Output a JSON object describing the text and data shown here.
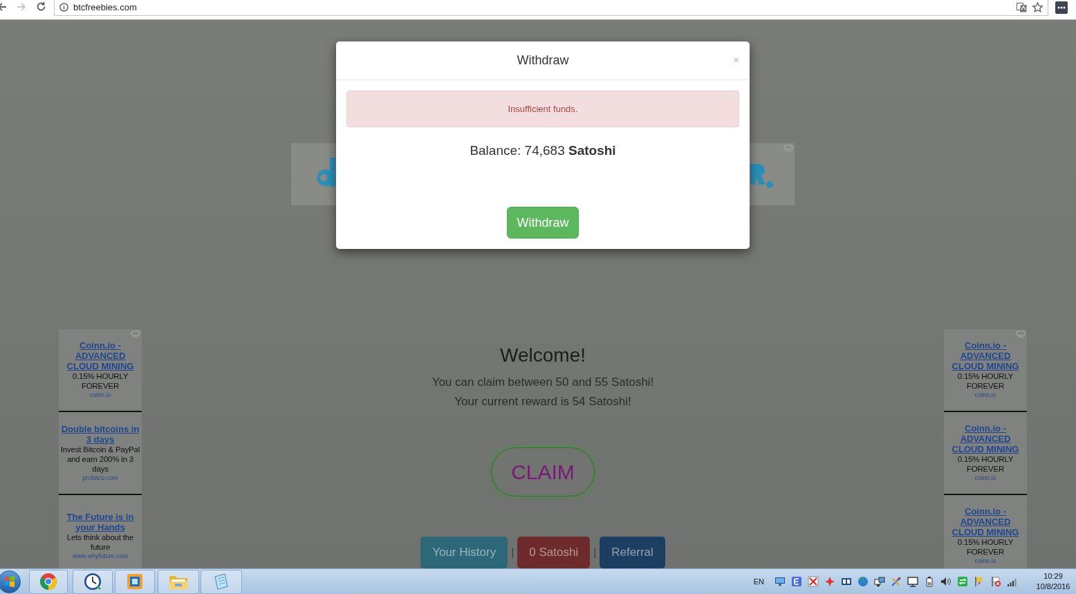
{
  "browser": {
    "url": "btcfreebies.com",
    "forward_disabled": true
  },
  "modal": {
    "title": "Withdraw",
    "close": "×",
    "alert": "Insufficient funds.",
    "balance": "Balance: 74,683 **Satoshi**",
    "button": "Withdraw"
  },
  "welcome": {
    "title": "Welcome!",
    "lines": [
      "You can claim between 50 and 55 Satoshi!",
      "Your current reward is 54 Satoshi!"
    ],
    "claim": "CLAIM"
  },
  "nav": [
    {
      "kind": "button",
      "label": "Your History",
      "color": "#2d6878"
    },
    {
      "kind": "separator",
      "label": "|"
    },
    {
      "kind": "button",
      "label": "0 Satoshi",
      "color": "#6e2b2b"
    },
    {
      "kind": "separator",
      "label": "|"
    },
    {
      "kind": "button",
      "label": "Referral",
      "color": "#1c3e60"
    }
  ],
  "left_ads": [
    {
      "title": "Coinn.io - ADVANCED CLOUD MINING",
      "text": "0.15% HOURLY FOREVER",
      "url": "coinn.io"
    },
    {
      "title": "Double bitcoins in 3 days",
      "text": "Invest Bitcoin & PayPal and earn 200% in 3 days",
      "url": "probitco.com"
    },
    {
      "title": "The Future is in your Hands",
      "text": "Lets think about the future",
      "url": "www.whyfuture.com"
    }
  ],
  "right_ads": [
    {
      "title": "Coinn.io - ADVANCED CLOUD MINING",
      "text": "0.15% HOURLY FOREVER",
      "url": "coinn.io"
    },
    {
      "title": "Coinn.io - ADVANCED CLOUD MINING",
      "text": "0.15% HOURLY FOREVER",
      "url": "coinn.io"
    },
    {
      "title": "Coinn.io - ADVANCED CLOUD MINING",
      "text": "0.15% HOURLY FOREVER",
      "url": "coinn.io"
    }
  ],
  "taskbar": {
    "language": "EN",
    "time": "10:29",
    "date": "10/8/2016"
  }
}
